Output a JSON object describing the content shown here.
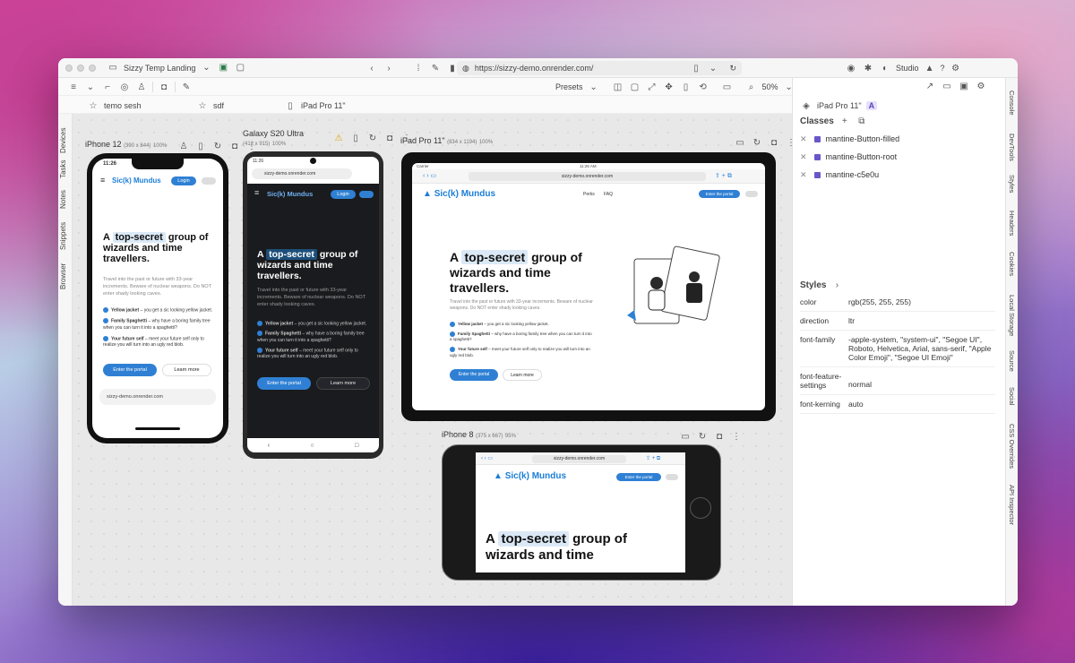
{
  "window": {
    "title": "Sizzy Temp Landing",
    "url": "https://sizzy-demo.onrender.com/",
    "studio_label": "Studio",
    "help_label": "?"
  },
  "toolbar": {
    "presets_label": "Presets",
    "zoom_label": "50%"
  },
  "bookmarks": [
    {
      "label": "temo sesh"
    },
    {
      "label": "sdf"
    },
    {
      "label": "iPad Pro 11\""
    }
  ],
  "left_sidebar": [
    "Devices",
    "Tasks",
    "Notes",
    "Snippets",
    "Browser"
  ],
  "right_sidebar": [
    "Console",
    "DevTools",
    "Styles",
    "Headers",
    "Cookies",
    "Local Storage",
    "Source",
    "Social",
    "CSS Overrides",
    "API Inspector"
  ],
  "devices": {
    "iphone12": {
      "name": "iPhone 12",
      "dims": "(390 x 844)",
      "zoom": "100%",
      "time": "11:26"
    },
    "galaxy": {
      "name": "Galaxy S20 Ultra",
      "dims": "(412 x 915)",
      "zoom": "100%",
      "time": "11:26"
    },
    "ipad": {
      "name": "iPad Pro 11\"",
      "dims": "(834 x 1194)",
      "zoom": "100%",
      "time": "11:26 AM",
      "carrier": "Carrier"
    },
    "iphone8": {
      "name": "iPhone 8",
      "dims": "(375 x 667)",
      "zoom": "95%"
    }
  },
  "site": {
    "url": "sizzy-demo.onrender.com",
    "brand": "Sic(k) Mundus",
    "login": "Login",
    "nav": [
      "Perks",
      "FAQ"
    ],
    "cta": "Enter the portal",
    "learn": "Learn more",
    "headline_a": "A",
    "headline_hl": "top-secret",
    "headline_rest": "group of wizards and time travellers.",
    "headline_short": "wizards and time",
    "headline_group_of": "group of",
    "intro": "Travel into the past or future with 33-year increments. Beware of nuclear weapons. Do NOT enter shady looking caves.",
    "features": [
      {
        "title": "Yellow jacket",
        "text": " – you get a sic looking yellow jacket."
      },
      {
        "title": "Family Spaghetti",
        "text": " – why have a boring family tree when you can turn it into a spaghetti?"
      },
      {
        "title": "Your future self",
        "text": " – meet your future self only to realize you will turn into an ugly red blob."
      }
    ]
  },
  "panel": {
    "device": "iPad Pro 11\"",
    "badge": "A",
    "classes_title": "Classes",
    "classes": [
      "mantine-Button-filled",
      "mantine-Button-root",
      "mantine-c5e0u"
    ],
    "styles_title": "Styles",
    "styles": [
      {
        "k": "color",
        "v": "rgb(255, 255, 255)"
      },
      {
        "k": "direction",
        "v": "ltr"
      },
      {
        "k": "font-family",
        "v": "-apple-system, \"system-ui\", \"Segoe UI\", Roboto, Helvetica, Arial, sans-serif, \"Apple Color Emoji\", \"Segoe UI Emoji\""
      },
      {
        "k": "font-feature-settings",
        "v": "normal"
      },
      {
        "k": "font-kerning",
        "v": "auto"
      }
    ]
  },
  "colors": {
    "accent": "#2f80d4",
    "brand": "#1c7ed6",
    "class_check": "#6b56c9"
  }
}
